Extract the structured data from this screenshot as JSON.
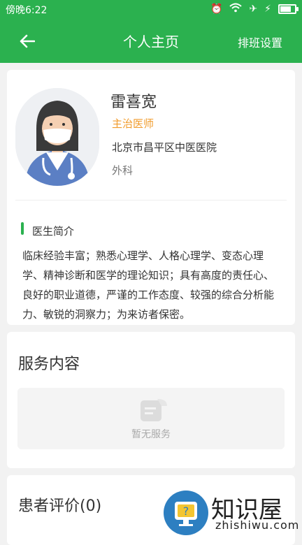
{
  "status_bar": {
    "time": "傍晚6:22"
  },
  "header": {
    "title": "个人主页",
    "action": "排班设置"
  },
  "doctor": {
    "name": "雷喜宽",
    "title": "主治医师",
    "hospital": "北京市昌平区中医医院",
    "department": "外科"
  },
  "intro": {
    "heading": "医生简介",
    "text": "临床经验丰富；熟悉心理学、人格心理学、变态心理学、精神诊断和医学的理论知识；具有高度的责任心、良好的职业道德，严谨的工作态度、较强的综合分析能力、敏锐的洞察力；为来访者保密。"
  },
  "services": {
    "heading": "服务内容",
    "empty_text": "暂无服务"
  },
  "reviews": {
    "heading": "患者评价(0)"
  },
  "watermark": {
    "name": "知识屋",
    "url": "zhishiwu.com"
  },
  "colors": {
    "primary": "#2bb14f",
    "title_orange": "#f19b2b"
  }
}
